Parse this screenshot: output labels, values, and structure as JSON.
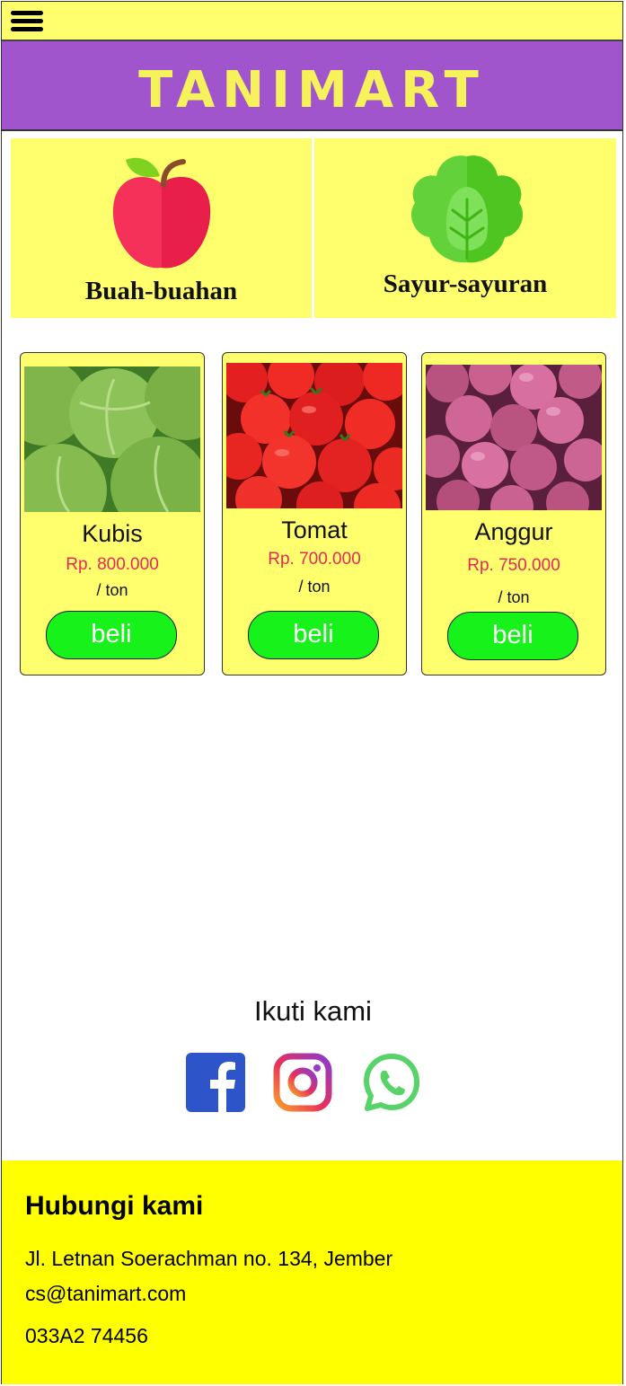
{
  "header": {
    "menu_icon": "hamburger-menu-icon",
    "brand": "TANIMART"
  },
  "categories": [
    {
      "label": "Buah-buahan",
      "icon": "apple-icon"
    },
    {
      "label": "Sayur-sayuran",
      "icon": "lettuce-icon"
    }
  ],
  "products": [
    {
      "name": "Kubis",
      "price": "Rp. 800.000",
      "unit": "/ ton",
      "button": "beli"
    },
    {
      "name": "Tomat",
      "price": "Rp. 700.000",
      "unit": "/ ton",
      "button": "beli"
    },
    {
      "name": "Anggur",
      "price": "Rp. 750.000",
      "unit": "/ ton",
      "button": "beli"
    }
  ],
  "social": {
    "title": "Ikuti kami",
    "icons": [
      "facebook-icon",
      "instagram-icon",
      "whatsapp-icon"
    ]
  },
  "footer": {
    "title": "Hubungi kami",
    "address": "Jl. Letnan Soerachman no. 134, Jember",
    "email": "cs@tanimart.com",
    "phone": "033A2 74456"
  },
  "colors": {
    "topbar": "#ffff6e",
    "banner": "#a155cc",
    "brand_text": "#f6f25c",
    "card": "#ffff6e",
    "price": "#e8275b",
    "buy_button": "#16f21a",
    "footer": "#ffff00"
  }
}
